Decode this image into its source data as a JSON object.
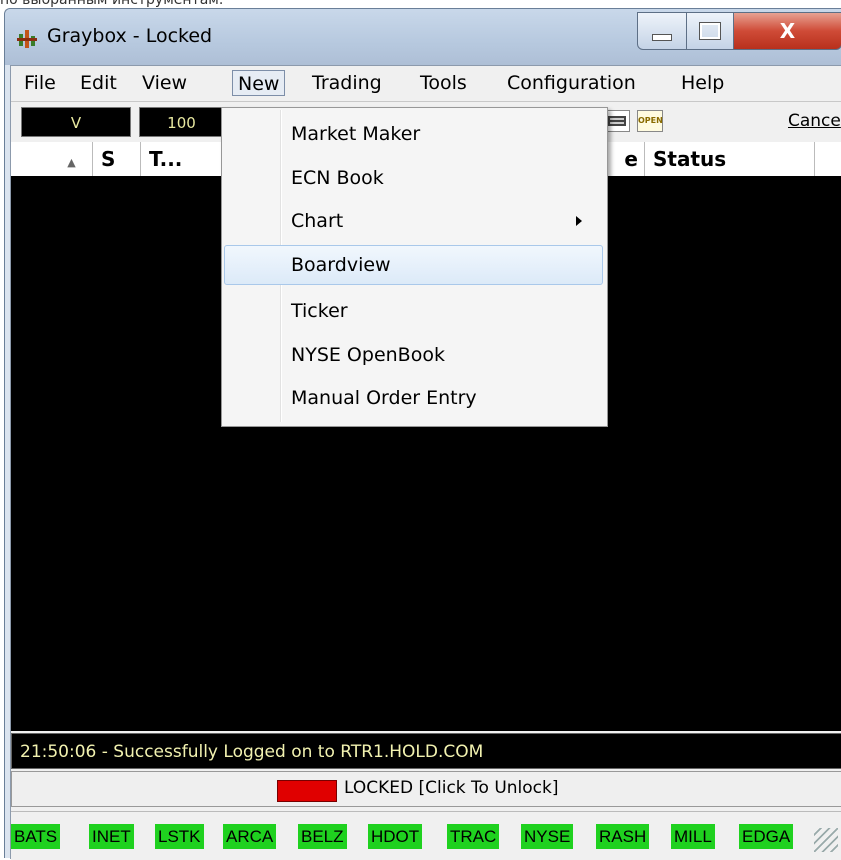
{
  "stray_text": "по выбранным инструментам.",
  "window": {
    "title": "Graybox - Locked",
    "close_glyph": "X"
  },
  "menubar": [
    "File",
    "Edit",
    "View",
    "New",
    "Trading",
    "Tools",
    "Configuration",
    "Help"
  ],
  "toolbar": {
    "symbol": "V",
    "quantity": "100",
    "open_icon": "OPEN",
    "cancel_label": "Cance"
  },
  "grid": {
    "sort_glyph": "▲",
    "columns": [
      "S",
      "T...",
      "e",
      "Status"
    ]
  },
  "new_menu": {
    "items": [
      "Market Maker",
      "ECN Book",
      "Chart",
      "Boardview",
      "Ticker",
      "NYSE OpenBook",
      "Manual Order Entry"
    ],
    "highlighted": "Boardview",
    "submenu_item": "Chart"
  },
  "log_message": "21:50:06 - Successfully Logged on to RTR1.HOLD.COM",
  "lock": {
    "label": "LOCKED [Click To Unlock]",
    "color": "#e00000"
  },
  "exchanges": [
    "BATS",
    "INET",
    "LSTK",
    "ARCA",
    "BELZ",
    "HDOT",
    "TRAC",
    "NYSE",
    "RASH",
    "MILL",
    "EDGA"
  ],
  "colors": {
    "exchange_bg": "#1fd11f",
    "grid_bg": "#000000",
    "title_close": "#cf4b37"
  }
}
